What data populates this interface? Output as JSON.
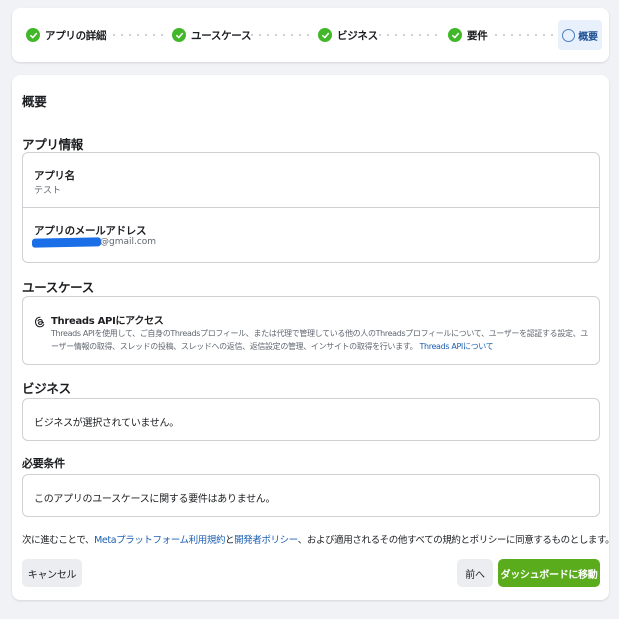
{
  "stepper": {
    "steps": [
      {
        "label": "アプリの詳細",
        "status": "done"
      },
      {
        "label": "ユースケース",
        "status": "done"
      },
      {
        "label": "ビジネス",
        "status": "done"
      },
      {
        "label": "要件",
        "status": "done"
      },
      {
        "label": "概要",
        "status": "current"
      }
    ],
    "done_color": "#42b72a",
    "current_color": "#4a7fc4"
  },
  "summary": {
    "title": "概要",
    "app_info": {
      "heading": "アプリ情報",
      "app_name_label": "アプリ名",
      "app_name_value": "テスト",
      "email_label": "アプリのメールアドレス",
      "email_value_visible": "@gmail.com"
    },
    "use_case": {
      "heading": "ユースケース",
      "icon": "threads-icon",
      "title": "Threads APIにアクセス",
      "description": "Threads APIを使用して、ご自身のThreadsプロフィール、または代理で管理している他の人のThreadsプロフィールについて、ユーザーを認証する設定、ユーザー情報の取得、スレッドの投稿、スレッドへの返信、返信設定の管理、インサイトの取得を行います。",
      "link": "Threads APIについて"
    },
    "business": {
      "heading": "ビジネス",
      "text": "ビジネスが選択されていません。"
    },
    "requirements": {
      "heading": "必要条件",
      "text": "このアプリのユースケースに関する要件はありません。"
    },
    "consent": {
      "prefix": "次に進むことで、",
      "link1": "Metaプラットフォーム利用規約",
      "mid": "と",
      "link2": "開発者ポリシー",
      "suffix": "、および適用されるその他すべての規約とポリシーに同意するものとします。"
    },
    "buttons": {
      "cancel": "キャンセル",
      "prev": "前へ",
      "go_dashboard": "ダッシュボードに移動"
    }
  }
}
